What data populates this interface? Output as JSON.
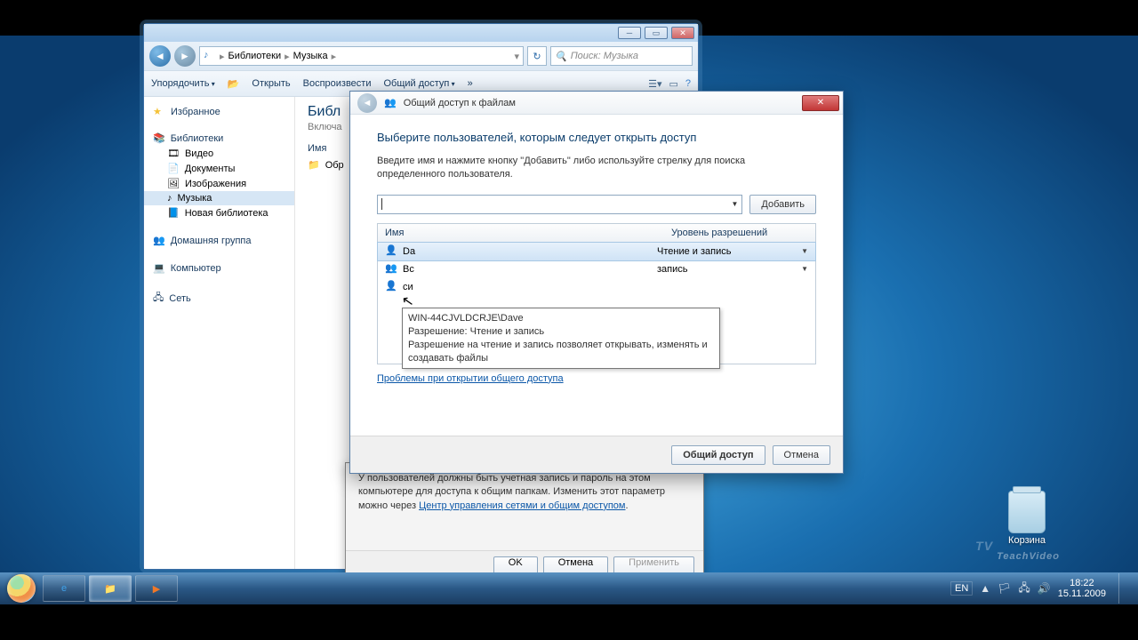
{
  "explorer": {
    "breadcrumb": {
      "root": "Библиотеки",
      "current": "Музыка"
    },
    "search_placeholder": "Поиск: Музыка",
    "toolbar": {
      "organize": "Упорядочить",
      "open": "Открыть",
      "play": "Воспроизвести",
      "share": "Общий доступ",
      "more": "»"
    },
    "sidebar": {
      "favorites": "Избранное",
      "libraries": "Библиотеки",
      "items": [
        "Видео",
        "Документы",
        "Изображения",
        "Музыка",
        "Новая библиотека"
      ],
      "homegroup": "Домашняя группа",
      "computer": "Компьютер",
      "network": "Сеть"
    },
    "content": {
      "title_prefix": "Библ",
      "subtitle_prefix": "Включа",
      "col_name": "Имя",
      "folder": "Обр"
    }
  },
  "wizard": {
    "title": "Общий доступ к файлам",
    "heading": "Выберите пользователей, которым следует открыть доступ",
    "instruction": "Введите имя и нажмите кнопку \"Добавить\" либо используйте стрелку для поиска определенного пользователя.",
    "add_btn": "Добавить",
    "columns": {
      "name": "Имя",
      "perm": "Уровень разрешений"
    },
    "rows": [
      {
        "name": "Da",
        "perm": "Чтение и запись"
      },
      {
        "name": "Вс",
        "perm": "запись"
      },
      {
        "name": "си",
        "perm": ""
      }
    ],
    "tooltip": {
      "line1": "WIN-44CJVLDCRJE\\Dave",
      "line2": "Разрешение: Чтение и запись",
      "line3": "Разрешение на чтение и запись позволяет открывать, изменять и создавать файлы"
    },
    "trouble_link": "Проблемы при открытии общего доступа",
    "share_btn": "Общий доступ",
    "cancel_btn": "Отмена"
  },
  "propdlg": {
    "msg_part1": "У пользователей должны быть учетная запись и пароль на этом компьютере для доступа к общим папкам. Изменить этот параметр можно через ",
    "link": "Центр управления сетями и общим доступом",
    "ok": "OK",
    "cancel": "Отмена",
    "apply": "Применить"
  },
  "desktop": {
    "recycle": "Корзина",
    "watermark": "TeachVideo"
  },
  "taskbar": {
    "lang": "EN",
    "time": "18:22",
    "date": "15.11.2009"
  }
}
